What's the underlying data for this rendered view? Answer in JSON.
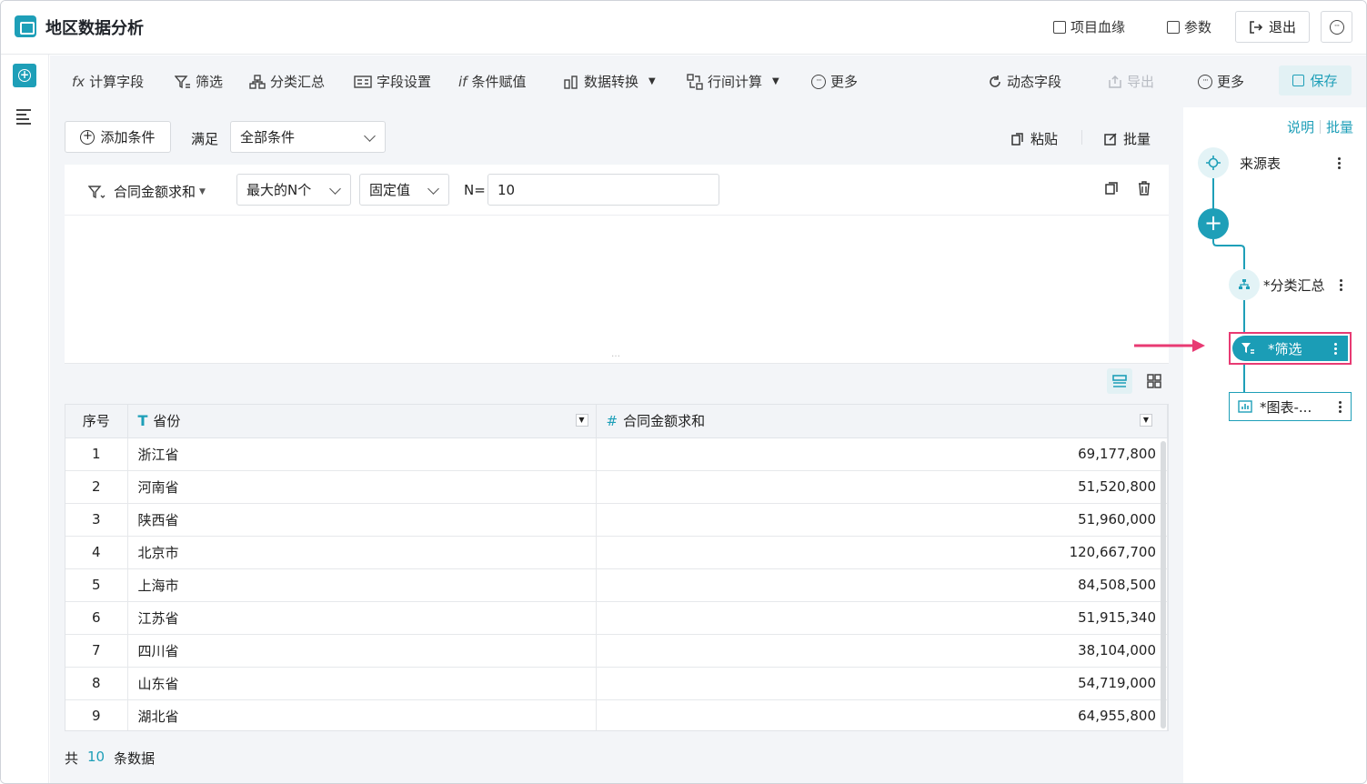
{
  "header": {
    "title": "地区数据分析",
    "lineage_label": "项目血缘",
    "params_label": "参数",
    "exit_label": "退出"
  },
  "toolbar": {
    "calc_field": "计算字段",
    "filter": "筛选",
    "group_summary": "分类汇总",
    "field_settings": "字段设置",
    "condition_assign": "条件赋值",
    "data_transform": "数据转换",
    "row_calc": "行间计算",
    "more_left": "更多",
    "dynamic_field": "动态字段",
    "export": "导出",
    "more_right": "更多",
    "save": "保存"
  },
  "condition_bar": {
    "add_condition": "添加条件",
    "satisfy_label": "满足",
    "satisfy_value": "全部条件",
    "paste": "粘贴",
    "batch": "批量"
  },
  "condition": {
    "field": "合同金额求和",
    "operator": "最大的N个",
    "value_type": "固定值",
    "n_label": "N=",
    "n_value": "10"
  },
  "table": {
    "headers": {
      "index": "序号",
      "province": "省份",
      "amount": "合同金额求和"
    },
    "rows": [
      {
        "idx": "1",
        "province": "浙江省",
        "amount": "69,177,800"
      },
      {
        "idx": "2",
        "province": "河南省",
        "amount": "51,520,800"
      },
      {
        "idx": "3",
        "province": "陕西省",
        "amount": "51,960,000"
      },
      {
        "idx": "4",
        "province": "北京市",
        "amount": "120,667,700"
      },
      {
        "idx": "5",
        "province": "上海市",
        "amount": "84,508,500"
      },
      {
        "idx": "6",
        "province": "江苏省",
        "amount": "51,915,340"
      },
      {
        "idx": "7",
        "province": "四川省",
        "amount": "38,104,000"
      },
      {
        "idx": "8",
        "province": "山东省",
        "amount": "54,719,000"
      },
      {
        "idx": "9",
        "province": "湖北省",
        "amount": "64,955,800"
      }
    ]
  },
  "footer": {
    "prefix": "共",
    "count": "10",
    "suffix": "条数据"
  },
  "flow": {
    "help_link": "说明",
    "batch_link": "批量",
    "source_node": "来源表",
    "group_node": "*分类汇总",
    "filter_node": "*筛选",
    "chart_node": "*图表-..."
  },
  "colors": {
    "accent": "#1e9fb8",
    "highlight": "#e83a73"
  }
}
